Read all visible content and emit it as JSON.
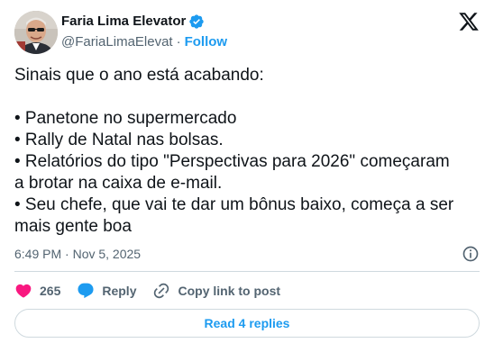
{
  "author": {
    "display_name": "Faria Lima Elevator",
    "handle": "@FariaLimaElevat",
    "separator": "·",
    "follow_label": "Follow"
  },
  "tweet": {
    "lines": [
      "Sinais que o ano está acabando:",
      "",
      "• Panetone no supermercado",
      "• Rally de Natal nas bolsas.",
      "• Relatórios do tipo \"Perspectivas para 2026\" começaram",
      "a brotar na caixa de e-mail.",
      "• Seu chefe, que vai te dar um bônus baixo, começa a ser",
      "mais gente boa"
    ],
    "timestamp": "6:49 PM · Nov 5, 2025"
  },
  "actions": {
    "like_count": "265",
    "reply_label": "Reply",
    "copy_label": "Copy link to post"
  },
  "replies": {
    "label": "Read 4 replies"
  },
  "colors": {
    "accent": "#1d9bf0",
    "like": "#f91880",
    "text": "#0f1419",
    "muted": "#536471",
    "border": "#cfd9de"
  },
  "icons": [
    "verified-badge-icon",
    "x-logo-icon",
    "info-icon",
    "heart-icon",
    "reply-bubble-icon",
    "link-icon"
  ]
}
